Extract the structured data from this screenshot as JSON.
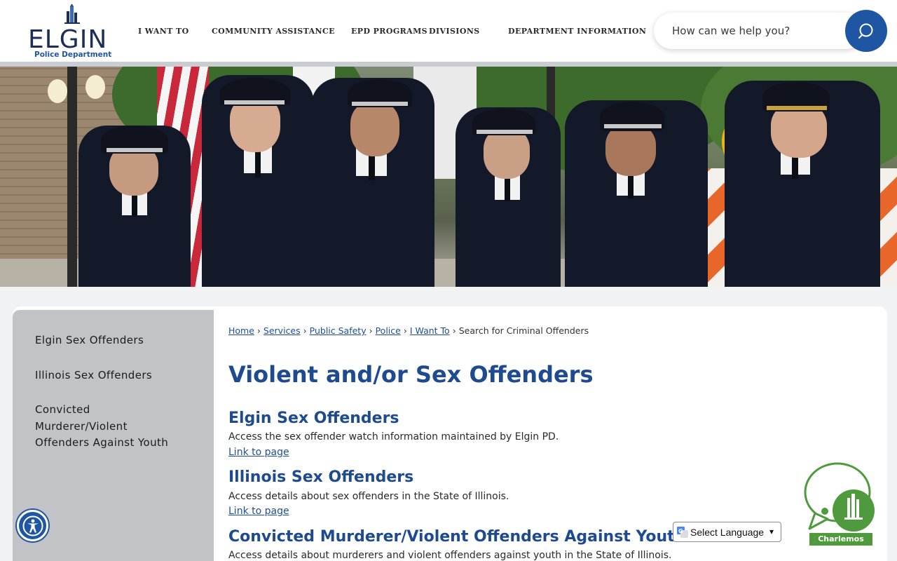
{
  "header": {
    "logo_word": "ELGIN",
    "logo_sub": "Police Department",
    "nav": [
      {
        "label": "I WANT TO"
      },
      {
        "label": "COMMUNITY ASSISTANCE"
      },
      {
        "label": "EPD PROGRAMS"
      },
      {
        "label": "DIVISIONS"
      },
      {
        "label": "DEPARTMENT INFORMATION"
      }
    ],
    "search_placeholder": "How can we help you?"
  },
  "sidebar": {
    "items": [
      {
        "label": "Elgin Sex Offenders"
      },
      {
        "label": "Illinois Sex Offenders"
      },
      {
        "label": "Convicted Murderer/Violent Offenders Against Youth"
      }
    ]
  },
  "breadcrumb": {
    "items": [
      {
        "label": "Home"
      },
      {
        "label": "Services"
      },
      {
        "label": "Public Safety"
      },
      {
        "label": "Police"
      },
      {
        "label": "I Want To"
      }
    ],
    "sep": "›",
    "current": "Search for Criminal Offenders"
  },
  "main": {
    "title": "Violent and/or Sex Offenders",
    "sections": [
      {
        "title": "Elgin Sex Offenders",
        "desc": "Access the sex offender watch information maintained by Elgin PD.",
        "link": "Link to page"
      },
      {
        "title": "Illinois Sex Offenders",
        "desc": "Access details about sex offenders in the State of Illinois.",
        "link": "Link to page"
      },
      {
        "title": "Convicted Murderer/Violent Offenders Against Youth",
        "desc": "Access details about murderers and violent offenders against youth in the State of Illinois."
      }
    ]
  },
  "widgets": {
    "language_label": "Select Language",
    "chat_label": "Charlemos"
  },
  "icons": {
    "search": "search-icon",
    "accessibility": "accessibility-icon",
    "google_translate": "google-translate-icon",
    "chat": "chat-bubble-icon"
  },
  "colors": {
    "brand_blue": "#1f56a3",
    "title_blue": "#1e4a8f",
    "chat_green": "#4f9a3d",
    "sidebar_gray": "#c1c3c7"
  }
}
